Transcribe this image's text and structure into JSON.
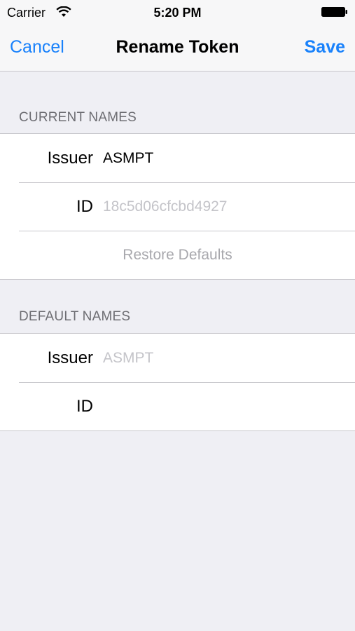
{
  "status_bar": {
    "carrier": "Carrier",
    "time": "5:20 PM",
    "wifi_icon": "wifi-icon",
    "battery_icon": "battery-full-icon"
  },
  "nav": {
    "cancel_label": "Cancel",
    "title": "Rename Token",
    "save_label": "Save",
    "accent_color": "#1a82fb"
  },
  "current_names": {
    "header": "CURRENT NAMES",
    "issuer_label": "Issuer",
    "issuer_value": "ASMPT",
    "id_label": "ID",
    "id_placeholder": "18c5d06cfcbd4927",
    "restore_label": "Restore Defaults"
  },
  "default_names": {
    "header": "DEFAULT NAMES",
    "issuer_label": "Issuer",
    "issuer_value": "ASMPT",
    "id_label": "ID",
    "id_value": ""
  }
}
